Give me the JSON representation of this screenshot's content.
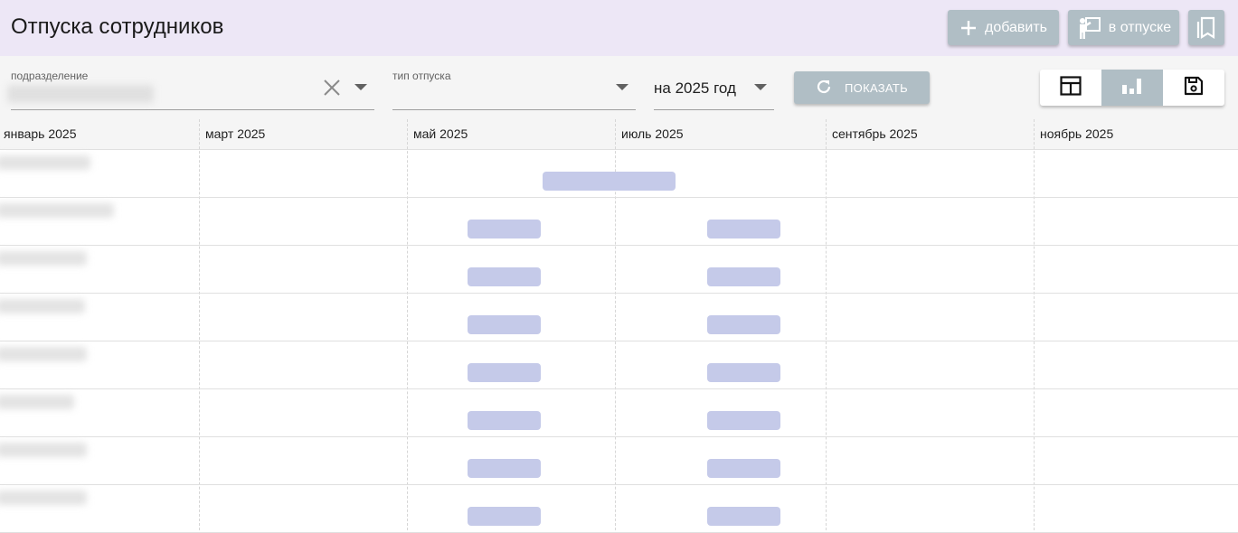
{
  "header": {
    "title": "Отпуска сотрудников",
    "add_label": "добавить",
    "on_vacation_label": "в отпуске"
  },
  "filters": {
    "department": {
      "label": "подразделение",
      "value": ""
    },
    "vacation_type": {
      "label": "тип отпуска",
      "value": ""
    },
    "year": {
      "value": "на 2025 год"
    },
    "show_label": "ПОКАЗАТЬ",
    "views": [
      "table-icon",
      "chart-icon",
      "save-icon"
    ],
    "active_view": "chart-icon"
  },
  "timeline": {
    "months": [
      "январь 2025",
      "март 2025",
      "май 2025",
      "июль 2025",
      "сентябрь 2025",
      "ноябрь 2025"
    ],
    "rows": [
      {
        "name": "",
        "bars": [
          {
            "start_month": 4.72,
            "end_month": 6.0
          }
        ]
      },
      {
        "name": "",
        "bars": [
          {
            "start_month": 4.0,
            "end_month": 4.7
          },
          {
            "start_month": 6.3,
            "end_month": 7.0
          }
        ]
      },
      {
        "name": "",
        "bars": [
          {
            "start_month": 4.0,
            "end_month": 4.7
          },
          {
            "start_month": 6.3,
            "end_month": 7.0
          }
        ]
      },
      {
        "name": "",
        "bars": [
          {
            "start_month": 4.0,
            "end_month": 4.7
          },
          {
            "start_month": 6.3,
            "end_month": 7.0
          }
        ]
      },
      {
        "name": "",
        "bars": [
          {
            "start_month": 4.0,
            "end_month": 4.7
          },
          {
            "start_month": 6.3,
            "end_month": 7.0
          }
        ]
      },
      {
        "name": "",
        "bars": [
          {
            "start_month": 4.0,
            "end_month": 4.7
          },
          {
            "start_month": 6.3,
            "end_month": 7.0
          }
        ]
      },
      {
        "name": "",
        "bars": [
          {
            "start_month": 4.0,
            "end_month": 4.7
          },
          {
            "start_month": 6.3,
            "end_month": 7.0
          }
        ]
      },
      {
        "name": "",
        "bars": [
          {
            "start_month": 4.0,
            "end_month": 4.7
          },
          {
            "start_month": 6.3,
            "end_month": 7.0
          }
        ]
      }
    ]
  },
  "colors": {
    "header_bg": "#ede7f6",
    "button_bg": "#b0bec5",
    "bar": "#c5cae9"
  }
}
